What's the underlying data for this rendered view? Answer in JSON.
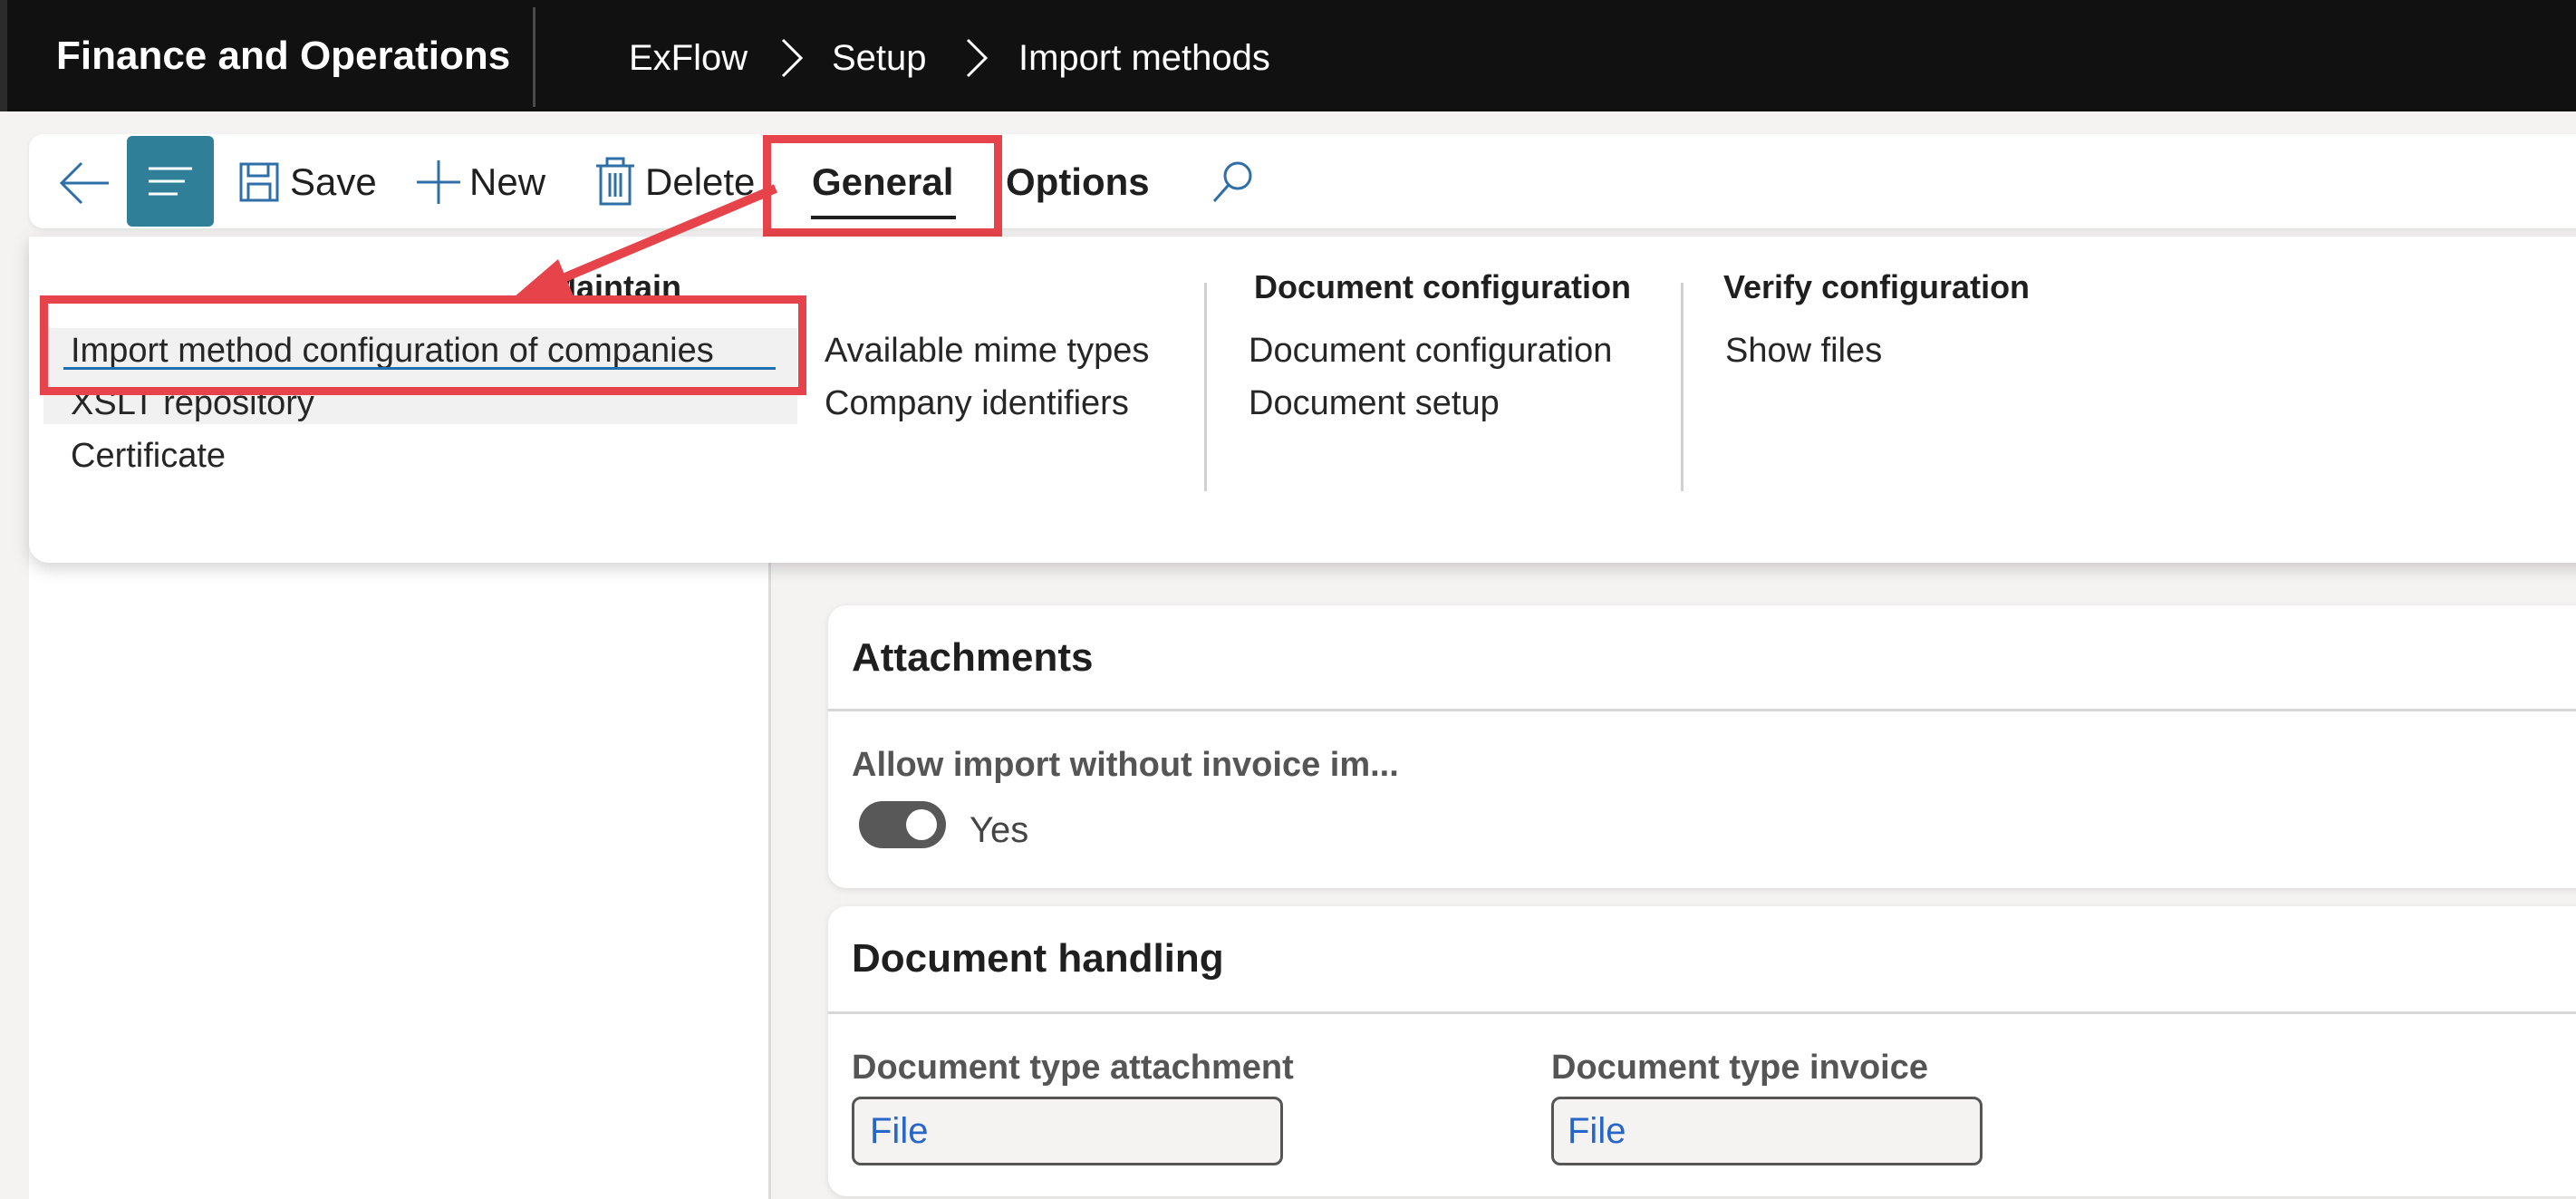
{
  "topbar": {
    "app_title": "Finance and Operations",
    "breadcrumb": [
      "ExFlow",
      "Setup",
      "Import methods"
    ]
  },
  "actionbar": {
    "save": "Save",
    "new": "New",
    "delete": "Delete",
    "general": "General",
    "options": "Options"
  },
  "panel": {
    "maintain_header": "Maintain",
    "maintain_items": [
      "Import method configuration of companies",
      "XSLT repository",
      "Certificate"
    ],
    "col2_items": [
      "Available mime types",
      "Company identifiers"
    ],
    "document_configuration_header": "Document configuration",
    "document_configuration_items": [
      "Document configuration",
      "Document setup"
    ],
    "verify_configuration_header": "Verify configuration",
    "verify_configuration_items": [
      "Show files"
    ]
  },
  "attachments": {
    "title": "Attachments",
    "field_label": "Allow import without invoice im...",
    "toggle_value": "Yes",
    "toggle_on": true
  },
  "document_handling": {
    "title": "Document handling",
    "attachment_label": "Document type attachment",
    "attachment_value": "File",
    "invoice_label": "Document type invoice",
    "invoice_value": "File"
  },
  "colors": {
    "highlight": "#e7434a",
    "accent": "#2f7f98",
    "link": "#2566c8"
  },
  "icons": [
    "back-arrow-icon",
    "hamburger-menu-icon",
    "save-icon",
    "plus-icon",
    "trash-icon",
    "search-icon",
    "chevron-right-icon"
  ]
}
